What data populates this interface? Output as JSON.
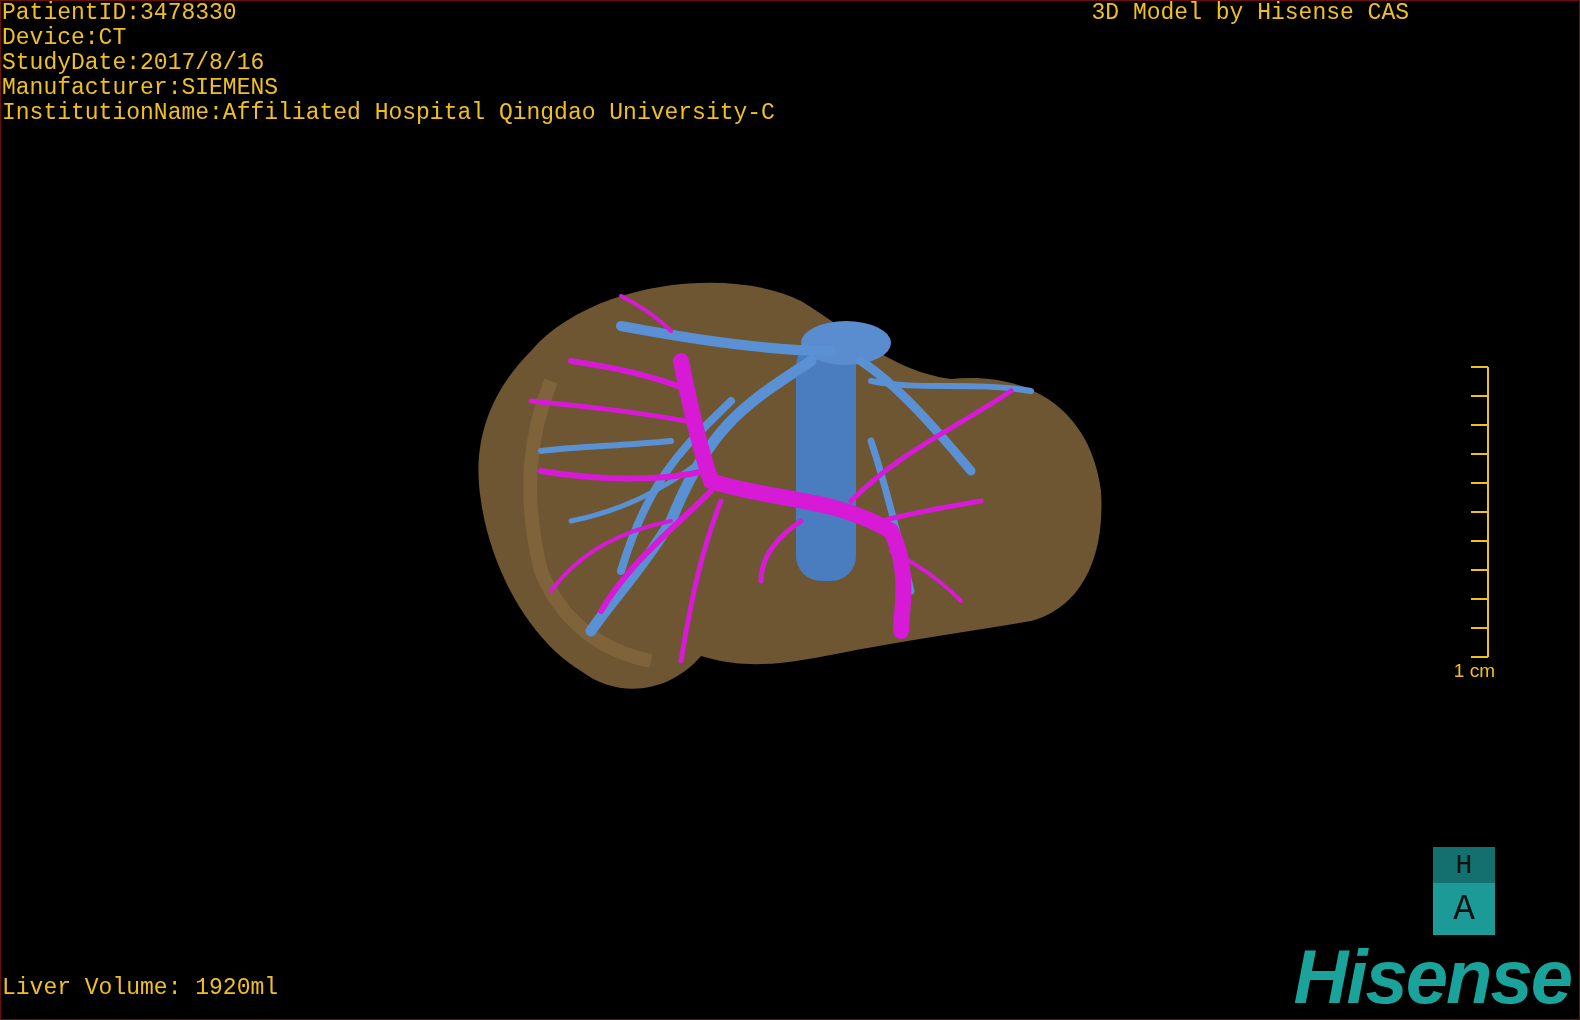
{
  "info_lines": [
    "PatientID:3478330",
    "Device:CT",
    "StudyDate:2017/8/16",
    "Manufacturer:SIEMENS",
    "InstitutionName:Affiliated Hospital Qingdao University-C"
  ],
  "title": "3D Model by Hisense CAS",
  "scale": {
    "label": "1 cm"
  },
  "orientation": [
    "H",
    "A"
  ],
  "volume": "Liver Volume: 1920ml",
  "logo": "Hisense"
}
